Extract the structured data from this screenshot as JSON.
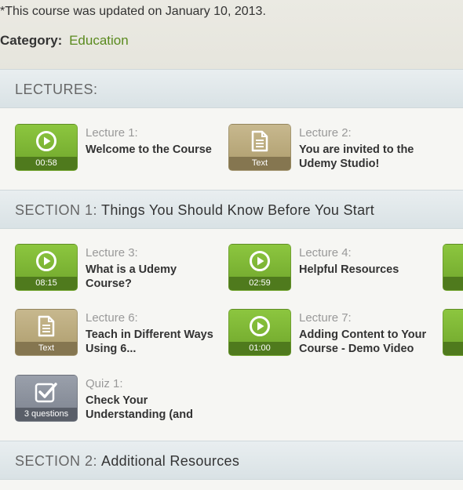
{
  "course": {
    "updated_text": "*This course was updated on January 10, 2013.",
    "category_label": "Category:",
    "category_value": "Education"
  },
  "lectures_header": {
    "prefix": "LECTURES:",
    "name": ""
  },
  "lectures": [
    {
      "number": "Lecture 1:",
      "title": "Welcome to the Course",
      "type": "video",
      "caption": "00:58",
      "icon": "play-icon"
    },
    {
      "number": "Lecture 2:",
      "title": "You are invited to the Udemy Studio!",
      "type": "text",
      "caption": "Text",
      "icon": "document-icon"
    }
  ],
  "section1": {
    "prefix": "SECTION 1:",
    "name": "Things You Should Know Before You Start",
    "items": [
      {
        "number": "Lecture 3:",
        "title": "What is a Udemy Course?",
        "type": "video",
        "caption": "08:15",
        "icon": "play-icon"
      },
      {
        "number": "Lecture 4:",
        "title": "Helpful Resources",
        "type": "video",
        "caption": "02:59",
        "icon": "play-icon"
      },
      {
        "number": "Lecture 6:",
        "title": "Teach in Different Ways Using 6...",
        "type": "text",
        "caption": "Text",
        "icon": "document-icon"
      },
      {
        "number": "Lecture 7:",
        "title": "Adding Content to Your Course - Demo Video",
        "type": "video",
        "caption": "01:00",
        "icon": "play-icon"
      },
      {
        "number": "Quiz 1:",
        "title": "Check Your Understanding (and explore the quiz tool)",
        "type": "quiz",
        "caption": "3 questions",
        "icon": "checkbox-icon"
      }
    ]
  },
  "section2": {
    "prefix": "SECTION 2:",
    "name": "Additional Resources"
  },
  "colors": {
    "video": "#7cb733",
    "text": "#b8a97d",
    "quiz": "#8a909b",
    "category_link": "#5a8a1e"
  }
}
